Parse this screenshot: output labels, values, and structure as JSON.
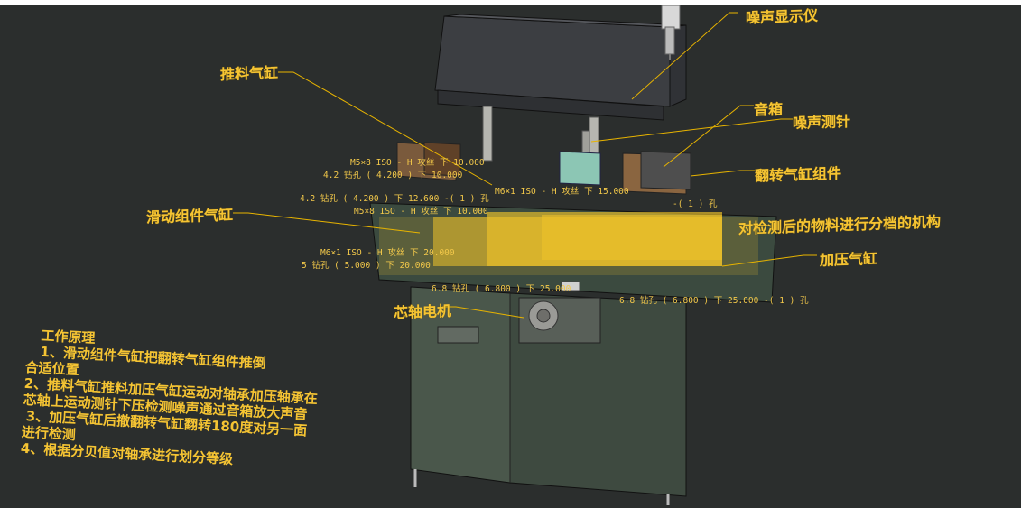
{
  "labels": {
    "noise_display": "噪声显示仪",
    "push_cylinder": "推料气缸",
    "sound_box": "音箱",
    "noise_probe": "噪声测针",
    "flip_cylinder": "翻转气缸组件",
    "slide_cylinder": "滑动组件气缸",
    "sorting_mechanism": "对检测后的物料进行分档的机构",
    "press_cylinder": "加压气缸",
    "spindle_motor": "芯轴电机"
  },
  "dimension_notes": [
    "M5×8 ISO - H 攻丝 下 10.000",
    "4.2 钻孔 ( 4.200 ) 下 10.000",
    "4.2 钻孔 ( 4.200 ) 下 12.600 -( 1 ) 孔",
    "M5×8 ISO - H 攻丝 下 10.000",
    "M6×1 ISO - H 攻丝 下 20.000",
    "5 钻孔 ( 5.000 ) 下 20.000",
    "6.8 钻孔 ( 6.800 ) 下 25.000",
    "6.8 钻孔 ( 6.800 ) 下 25.000 -( 1 ) 孔",
    "M6×1 ISO - H 攻丝 下 15.000",
    "-( 1 ) 孔"
  ],
  "principle": {
    "title": "工作原理",
    "lines": [
      "1、滑动组件气缸把翻转气缸组件推倒",
      "合适位置",
      "2、推料气缸推料加压气缸运动对轴承加压轴承在",
      "芯轴上运动测针下压检测噪声通过音箱放大声音",
      "3、加压气缸后撤翻转气缸翻转180度对另一面",
      "进行检测",
      "4、根据分贝值对轴承进行划分等级"
    ]
  },
  "colors": {
    "background": "#2b2e2d",
    "annotation": "#f5c433",
    "leader_line": "#e8b400"
  }
}
